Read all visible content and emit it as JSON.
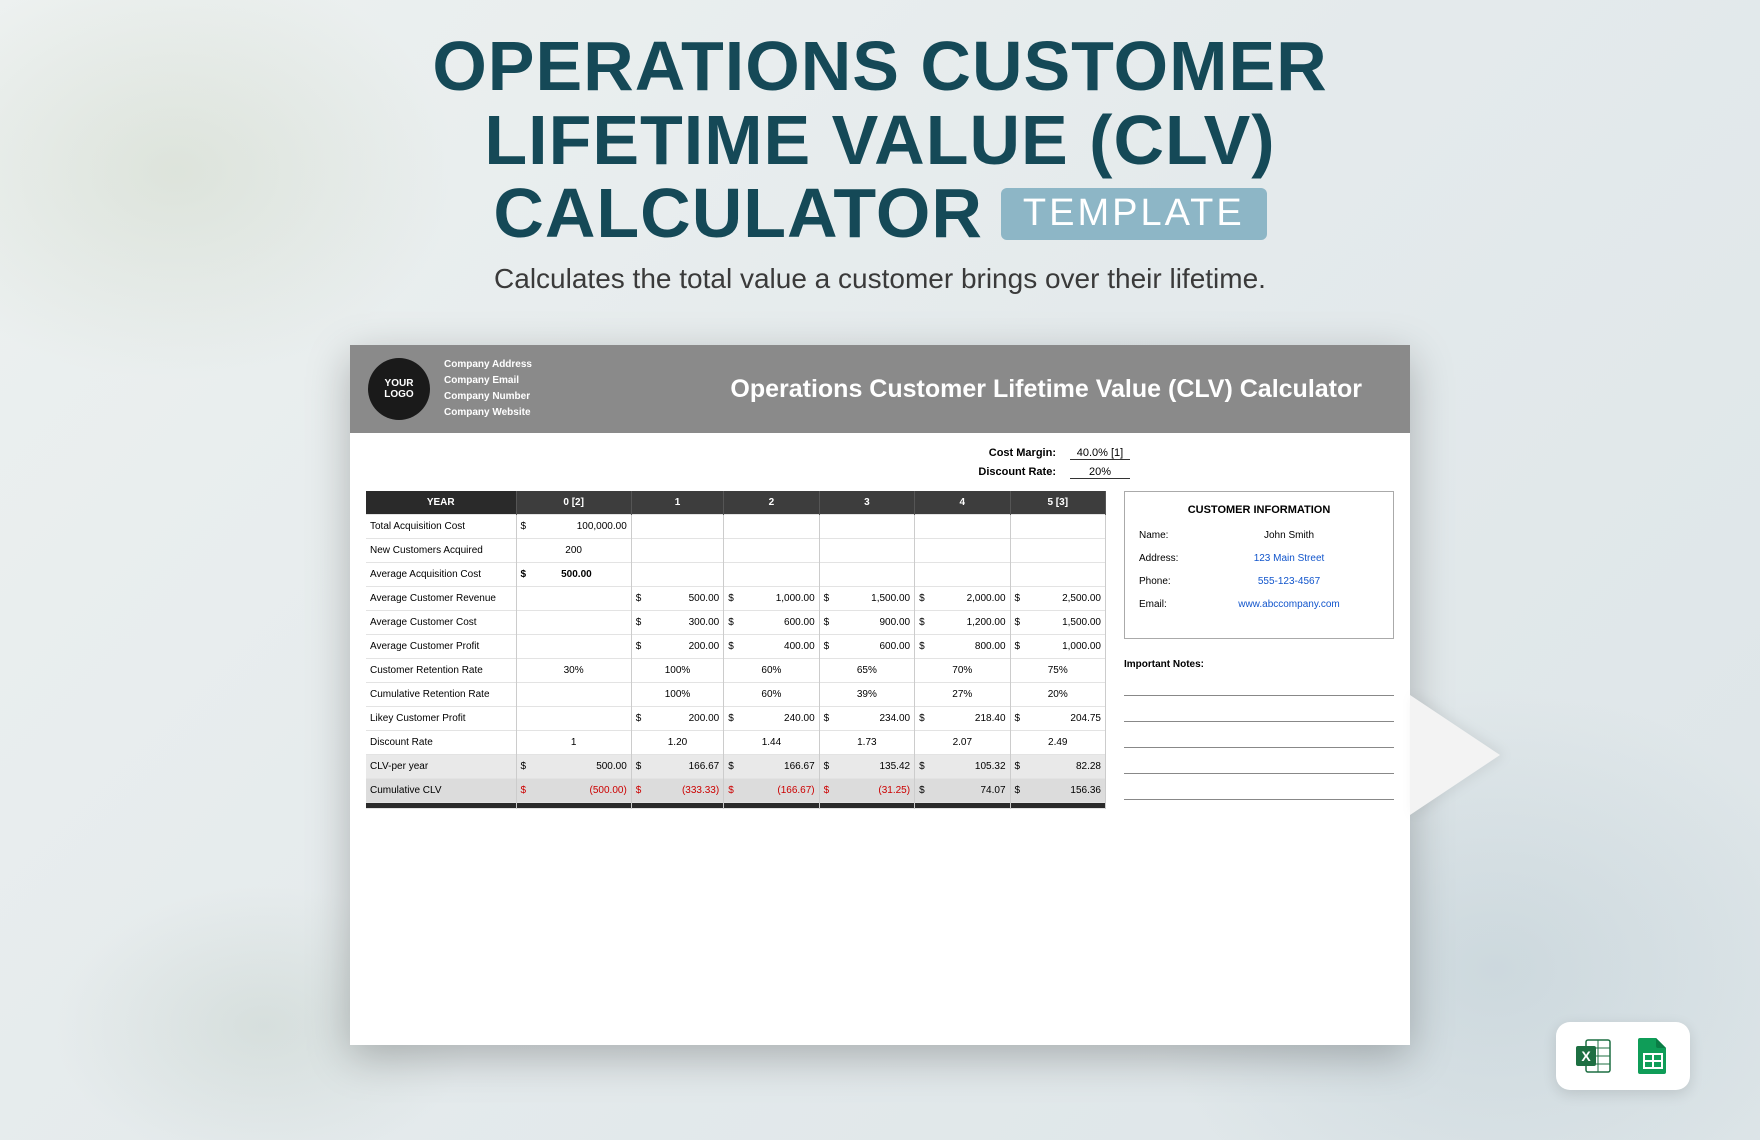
{
  "hero": {
    "line1": "OPERATIONS CUSTOMER",
    "line2": "LIFETIME VALUE (CLV)",
    "line3": "CALCULATOR",
    "badge": "TEMPLATE",
    "subtitle": "Calculates the total value a customer brings over their lifetime."
  },
  "doc": {
    "logo_top": "YOUR",
    "logo_bottom": "LOGO",
    "company_address": "Company Address",
    "company_email": "Company Email",
    "company_number": "Company Number",
    "company_website": "Company Website",
    "title": "Operations Customer Lifetime Value (CLV) Calculator",
    "cost_margin_label": "Cost Margin:",
    "cost_margin_value": "40.0% [1]",
    "discount_rate_label": "Discount Rate:",
    "discount_rate_value": "20%"
  },
  "table": {
    "year_header": "YEAR",
    "years": [
      "0 [2]",
      "1",
      "2",
      "3",
      "4",
      "5 [3]"
    ],
    "rows": {
      "tac": {
        "label": "Total Acquisition Cost",
        "vals": [
          "$ 100,000.00",
          "",
          "",
          "",
          "",
          ""
        ]
      },
      "nca": {
        "label": "New Customers Acquired",
        "vals": [
          "200",
          "",
          "",
          "",
          "",
          ""
        ],
        "center": true
      },
      "aac": {
        "label": "Average Acquisition Cost",
        "vals": [
          "$500.00",
          "",
          "",
          "",
          "",
          ""
        ],
        "center": true,
        "bold0": true
      },
      "acr": {
        "label": "Average Customer Revenue",
        "vals": [
          "",
          "$ 500.00",
          "$ 1,000.00",
          "$ 1,500.00",
          "$ 2,000.00",
          "$ 2,500.00"
        ]
      },
      "acc": {
        "label": "Average Customer Cost",
        "vals": [
          "",
          "$ 300.00",
          "$ 600.00",
          "$ 900.00",
          "$ 1,200.00",
          "$ 1,500.00"
        ]
      },
      "acp": {
        "label": "Average Customer Profit",
        "vals": [
          "",
          "$ 200.00",
          "$ 400.00",
          "$ 600.00",
          "$ 800.00",
          "$ 1,000.00"
        ]
      },
      "crr": {
        "label": "Customer Retention Rate",
        "vals": [
          "30%",
          "100%",
          "60%",
          "65%",
          "70%",
          "75%"
        ],
        "center": true
      },
      "cumr": {
        "label": "Cumulative Retention Rate",
        "vals": [
          "",
          "100%",
          "60%",
          "39%",
          "27%",
          "20%"
        ],
        "center": true
      },
      "lcp": {
        "label": "Likey Customer Profit",
        "vals": [
          "",
          "$ 200.00",
          "$ 240.00",
          "$ 234.00",
          "$ 218.40",
          "$ 204.75"
        ]
      },
      "dr": {
        "label": "Discount Rate",
        "vals": [
          "1",
          "1.20",
          "1.44",
          "1.73",
          "2.07",
          "2.49"
        ],
        "center": true
      },
      "clvy": {
        "label": "CLV-per year",
        "vals": [
          "$ 500.00",
          "$ 166.67",
          "$ 166.67",
          "$ 135.42",
          "$ 105.32",
          "$ 82.28"
        ]
      },
      "cumclv": {
        "label": "Cumulative CLV",
        "vals": [
          "$ (500.00)",
          "$ (333.33)",
          "$ (166.67)",
          "$ (31.25)",
          "$ 74.07",
          "$ 156.36"
        ]
      }
    }
  },
  "customer": {
    "heading": "CUSTOMER INFORMATION",
    "name_k": "Name:",
    "name_v": "John Smith",
    "addr_k": "Address:",
    "addr_v": "123 Main Street",
    "phone_k": "Phone:",
    "phone_v": "555-123-4567",
    "email_k": "Email:",
    "email_v": "www.abccompany.com",
    "notes_label": "Important Notes:"
  }
}
